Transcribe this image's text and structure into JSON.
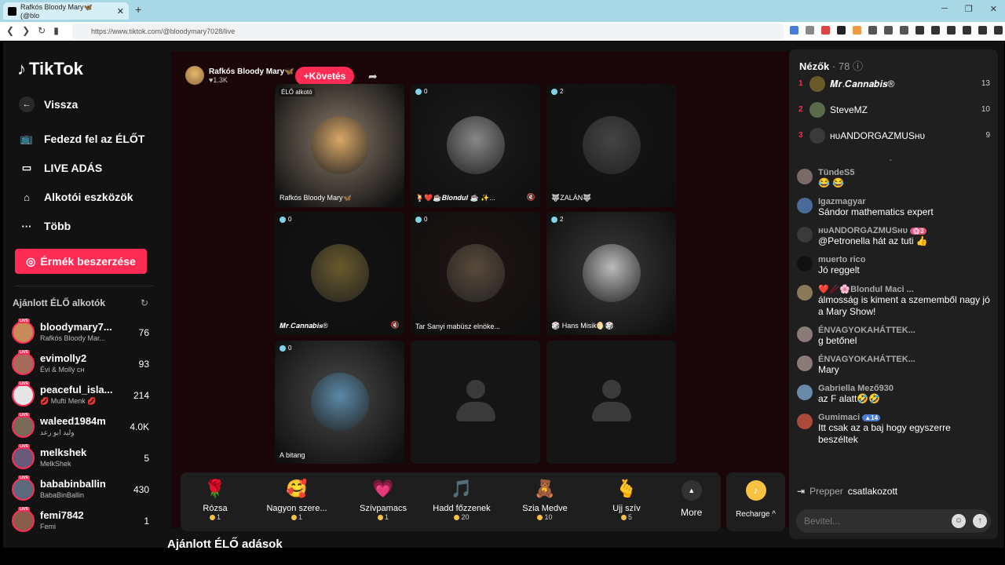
{
  "browser": {
    "tab_title": "Rafkós Bloody Mary🦋 (@blo",
    "url": "https://www.tiktok.com/@bloodymary7028/live"
  },
  "sidebar": {
    "logo": "TikTok",
    "back_label": "Vissza",
    "nav": [
      {
        "label": "Fedezd fel az ÉLŐT",
        "icon": "live-tv-icon"
      },
      {
        "label": "LIVE ADÁS",
        "icon": "video-camera-icon"
      },
      {
        "label": "Alkotói eszközök",
        "icon": "creator-tools-icon"
      },
      {
        "label": "Több",
        "icon": "more-dots-icon"
      }
    ],
    "coins_button": "Érmék beszerzése",
    "recommended_title": "Ajánlott ÉLŐ alkotók",
    "recommended": [
      {
        "name": "bloodymary7...",
        "sub": "Rafkós Bloody Mar...",
        "count": "76",
        "color": "#c98a5a"
      },
      {
        "name": "evimolly2",
        "sub": "Évi & Molly ᴄʜ",
        "count": "93",
        "color": "#a66b5a"
      },
      {
        "name": "peaceful_isla...",
        "sub": "💋 Mufti Menk 💋",
        "count": "214",
        "color": "#e6e6e6"
      },
      {
        "name": "waleed1984m",
        "sub": "وليد ابو رعد",
        "count": "4.0K",
        "color": "#7a6a5a"
      },
      {
        "name": "melkshek",
        "sub": "MelkShek",
        "count": "5",
        "color": "#6a5a7a"
      },
      {
        "name": "bababinballin",
        "sub": "BabaBinBallin",
        "count": "430",
        "color": "#5a6a7a"
      },
      {
        "name": "femi7842",
        "sub": "Femi",
        "count": "1",
        "color": "#8a5a4a"
      }
    ]
  },
  "stream": {
    "host_name": "Rafkós Bloody Mary🦋",
    "host_likes": "♥1.3K",
    "follow_label": "+Követés",
    "guests": [
      {
        "badge": "",
        "elo": "ÉLŐ alkotó",
        "name": "Rafkós Bloody Mary🦋",
        "muted": false,
        "face": "#d9a866",
        "bg": "#8a7a6a"
      },
      {
        "badge": "0",
        "elo": "",
        "name": "🍹❤️☕𝑩𝒍𝒐𝒏𝒅𝒖𝒍 ☕ ✨...",
        "muted": true,
        "face": "#888",
        "bg": "#1c1c1c"
      },
      {
        "badge": "2",
        "elo": "",
        "name": "🐺ZALÁN🐺",
        "muted": false,
        "face": "#444",
        "bg": "#151515"
      },
      {
        "badge": "0",
        "elo": "",
        "name": "𝑴𝒓.𝑪𝒂𝒏𝒏𝒂𝒃𝒊𝒔®",
        "muted": true,
        "face": "#6a5a2a",
        "bg": "#121212"
      },
      {
        "badge": "0",
        "elo": "",
        "name": "Tar Sanyi mabüsz elnöke...",
        "muted": false,
        "face": "#5a4a3a",
        "bg": "#1f1512"
      },
      {
        "badge": "2",
        "elo": "",
        "name": "🎲 Hans Misik🌖🎲",
        "muted": false,
        "face": "#bbb",
        "bg": "#3a3a3a"
      },
      {
        "badge": "0",
        "elo": "",
        "name": "A bitang",
        "muted": false,
        "face": "#5a8aa8",
        "bg": "#4a4a4a"
      }
    ],
    "gifts": [
      {
        "icon": "🌹",
        "name": "Rózsa",
        "price": "1"
      },
      {
        "icon": "🥰",
        "name": "Nagyon szere...",
        "price": "1"
      },
      {
        "icon": "💗",
        "name": "Szívpamacs",
        "price": "1"
      },
      {
        "icon": "🎵",
        "name": "Hadd főzzenek",
        "price": "20"
      },
      {
        "icon": "🧸",
        "name": "Szia Medve",
        "price": "10"
      },
      {
        "icon": "🫰",
        "name": "Ujj szív",
        "price": "5"
      }
    ],
    "more_label": "More",
    "recharge_label": "Recharge ^",
    "recommended_lives": "Ajánlott ÉLŐ adások"
  },
  "chat": {
    "viewers_label": "Nézők",
    "viewers_count": "· 78",
    "top_viewers": [
      {
        "rank": "1",
        "name": "𝑴𝒓.𝑪𝒂𝒏𝒏𝒂𝒃𝒊𝒔®",
        "score": "13",
        "color": "#6a5a2a"
      },
      {
        "rank": "2",
        "name": "SteveMZ",
        "score": "10",
        "color": "#5a6a4a"
      },
      {
        "rank": "3",
        "name": "ʜᴜANDORGAZMUSʜᴜ",
        "score": "9",
        "color": "#3a3a3a"
      }
    ],
    "messages": [
      {
        "user": "TündeS5",
        "text": "😂 😂",
        "color": "#7a6a6a",
        "level": ""
      },
      {
        "user": "Igazmagyar",
        "text": "Sándor mathematics expert",
        "color": "#4a6a9a",
        "level": ""
      },
      {
        "user": "ʜᴜANDORGAZMUSʜᴜ",
        "text": "@Petronella hát az tuti 👍",
        "color": "#3a3a3a",
        "level": "🌸3"
      },
      {
        "user": "muerto rico",
        "text": "Jó reggelt",
        "color": "#111",
        "level": ""
      },
      {
        "user": "❤️🥢🌸Blondul Maci ...",
        "text": "álmosság is kiment a szememből nagy jó a Mary Show!",
        "color": "#8a7a5a",
        "level": ""
      },
      {
        "user": "ÉNVAGYOKAHÁTTEK...",
        "text": "g betőnel",
        "color": "#8a7a7a",
        "level": ""
      },
      {
        "user": "ÉNVAGYOKAHÁTTEK...",
        "text": "Mary",
        "color": "#8a7a7a",
        "level": ""
      },
      {
        "user": "Gabriella Mező930",
        "text": "az F alatt🤣🤣",
        "color": "#6a8aaa",
        "level": ""
      },
      {
        "user": "Gumimaci",
        "text": "Itt csak az a baj hogy egyszerre beszéltek",
        "color": "#aa4a3a",
        "level": "▲14"
      }
    ],
    "joined_user": "Prepper",
    "joined_text": "csatlakozott",
    "input_placeholder": "Bevitel..."
  }
}
